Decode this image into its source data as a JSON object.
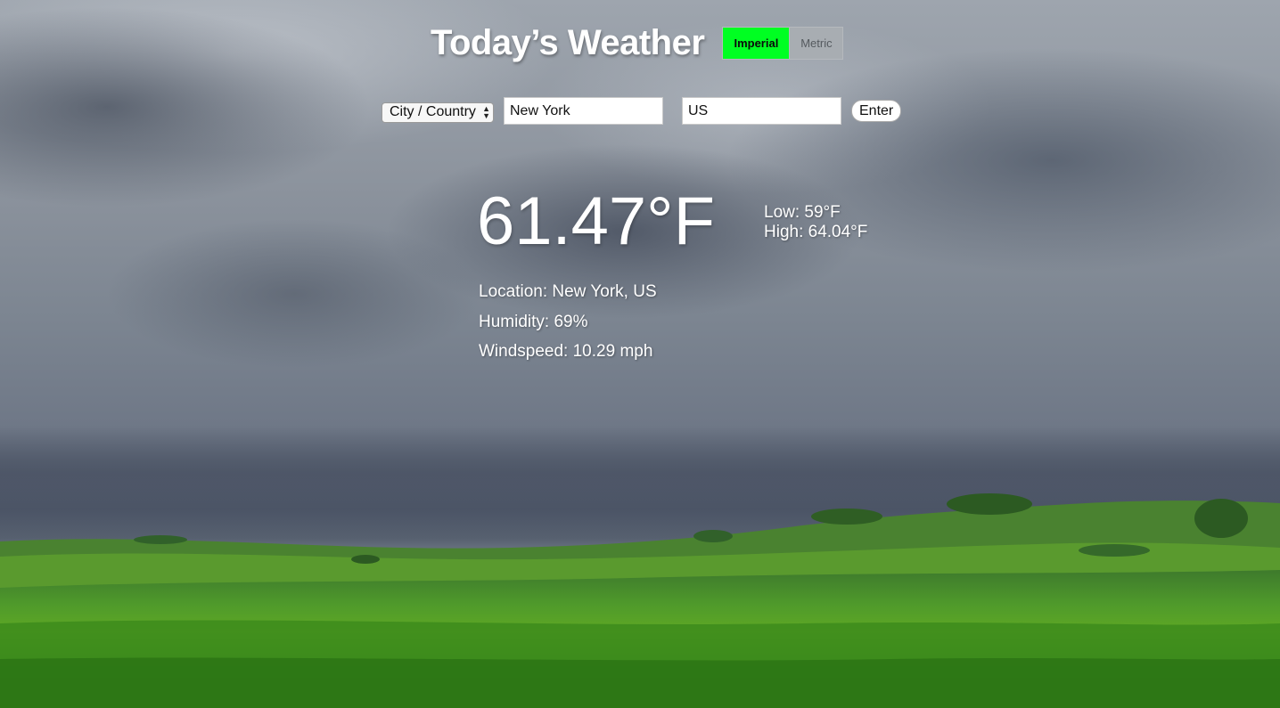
{
  "header": {
    "title": "Today’s Weather",
    "units": {
      "imperial_label": "Imperial",
      "metric_label": "Metric",
      "selected": "Imperial",
      "active_color": "#00ff22"
    }
  },
  "search": {
    "mode_select_value": "City / Country",
    "city_value": "New York",
    "country_value": "US",
    "enter_label": "Enter"
  },
  "weather": {
    "temperature": "61.47°F",
    "low": "Low: 59°F",
    "high": "High: 64.04°F",
    "location": "Location: New York, US",
    "humidity": "Humidity: 69%",
    "windspeed": "Windspeed: 10.29 mph"
  }
}
